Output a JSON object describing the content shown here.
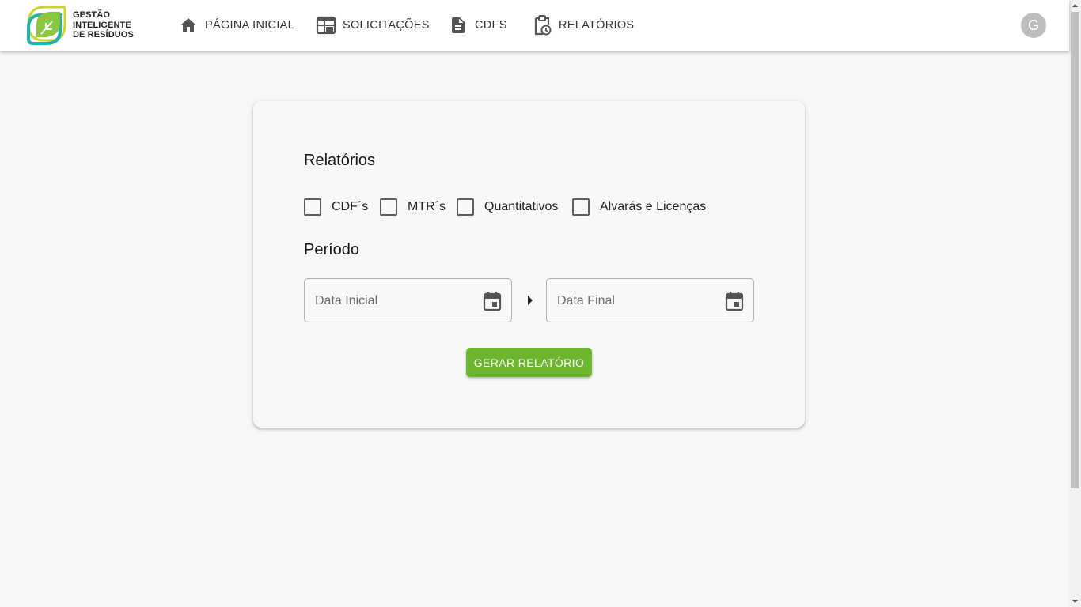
{
  "brand": {
    "logo_lines": [
      "GESTÃO",
      "INTELIGENTE",
      "DE RESÍDUOS"
    ],
    "colors": {
      "green": "#8dc63f",
      "teal": "#1fb3b0",
      "yellow": "#c9d52b"
    }
  },
  "nav": {
    "items": [
      {
        "label": "PÁGINA INICIAL",
        "icon": "home-icon"
      },
      {
        "label": "SOLICITAÇÕES",
        "icon": "table-icon"
      },
      {
        "label": "CDFS",
        "icon": "document-icon"
      },
      {
        "label": "RELATÓRIOS",
        "icon": "clipboard-clock-icon"
      }
    ]
  },
  "user": {
    "avatar_letter": "G"
  },
  "reports_card": {
    "title": "Relatórios",
    "options": [
      {
        "label": "CDF´s",
        "checked": false
      },
      {
        "label": "MTR´s",
        "checked": false
      },
      {
        "label": "Quantitativos",
        "checked": false
      },
      {
        "label": "Alvarás e Licenças",
        "checked": false
      }
    ],
    "period_title": "Período",
    "start_date": {
      "placeholder": "Data Inicial",
      "value": ""
    },
    "end_date": {
      "placeholder": "Data Final",
      "value": ""
    },
    "generate_label": "GERAR RELATÓRIO"
  },
  "theme": {
    "accent": "#6cb62f",
    "icon_color": "#545454"
  }
}
